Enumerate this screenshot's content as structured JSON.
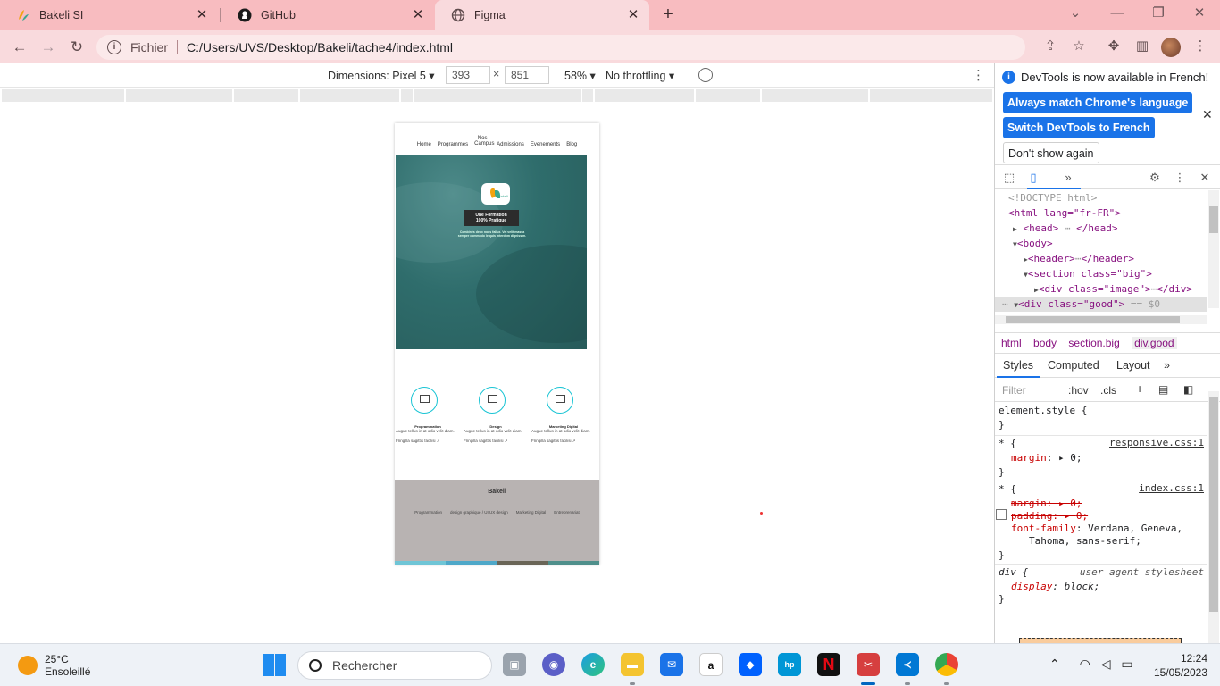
{
  "browser": {
    "tabs": [
      {
        "label": "Bakeli SI",
        "icon": "bakeli-favicon"
      },
      {
        "label": "GitHub",
        "icon": "github-icon"
      },
      {
        "label": "Figma",
        "icon": "globe-icon"
      }
    ],
    "address": {
      "scheme": "Fichier",
      "url": "C:/Users/UVS/Desktop/Bakeli/tache4/index.html"
    }
  },
  "device_toolbar": {
    "dimensions_label": "Dimensions: Pixel 5",
    "width": "393",
    "height": "851",
    "times": "×",
    "zoom": "58%",
    "throttling": "No throttling"
  },
  "page": {
    "nav": [
      "Home",
      "Programmes",
      "Nos Campus",
      "Admissions",
      "Evenements",
      "Blog"
    ],
    "hero": {
      "logo_text": "Bakeli",
      "title_line1": "Une Formation",
      "title_line2": "100% Pratique",
      "subtitle": "Combinés deux nous fallux. Vel velit massa semper commodo le quis interdum dignissim."
    },
    "features": [
      {
        "title": "Programmation",
        "desc": "Augue tellus in at odio velit diam.",
        "link": "Fringilla sagittis facilisi ↗"
      },
      {
        "title": "Design",
        "desc": "Augue tellus in at odio velit diam.",
        "link": "Fringilla sagittis facilisi ↗"
      },
      {
        "title": "Marketing Digital",
        "desc": "Augue tellus in at odio velit diam.",
        "link": "Fringilla sagittis facilisi ↗"
      }
    ],
    "footer": {
      "brand": "Bakeli",
      "links": [
        "Programmation",
        "design graphique / UI UX design",
        "Marketing Digital",
        "Entreprenariat"
      ]
    },
    "stripe_colors": [
      "#6fc5d6",
      "#4ea8c9",
      "#6a6557",
      "#4f8f8b"
    ]
  },
  "devtools": {
    "infobar": {
      "message": "DevTools is now available in French!",
      "btn_match": "Always match Chrome's language",
      "btn_switch": "Switch DevTools to French",
      "btn_dont": "Don't show again"
    },
    "dom": {
      "doctype": "<!DOCTYPE html>",
      "html_open": "<html lang=\"fr-FR\">",
      "head": "<head>",
      "head_close": "</head>",
      "body": "<body>",
      "header": "<header>",
      "header_close": "</header>",
      "section": "<section class=\"big\">",
      "div_image": "<div class=\"image\">",
      "div_image_close": "</div>",
      "div_good": "<div class=\"good\">",
      "eq": "== $0"
    },
    "breadcrumbs": [
      "html",
      "body",
      "section.big",
      "div.good"
    ],
    "style_tabs": [
      "Styles",
      "Computed",
      "Layout"
    ],
    "filter": {
      "placeholder": "Filter",
      "hov": ":hov",
      "cls": ".cls"
    },
    "rules": {
      "element_style": "element.style {",
      "close": "}",
      "star": "* {",
      "src_responsive": "responsive.css:1",
      "margin_decl": "margin",
      "zero": "0;",
      "src_index": "index.css:1",
      "padding_decl": "padding",
      "font_family": "font-family",
      "font_value1": "Verdana, Geneva,",
      "font_value2": "Tahoma, sans-serif;",
      "div_sel": "div {",
      "ua": "user agent stylesheet",
      "display": "display",
      "block": "block;"
    }
  },
  "taskbar": {
    "weather_temp": "25°C",
    "weather_desc": "Ensoleillé",
    "search_placeholder": "Rechercher",
    "time": "12:24",
    "date": "15/05/2023"
  }
}
